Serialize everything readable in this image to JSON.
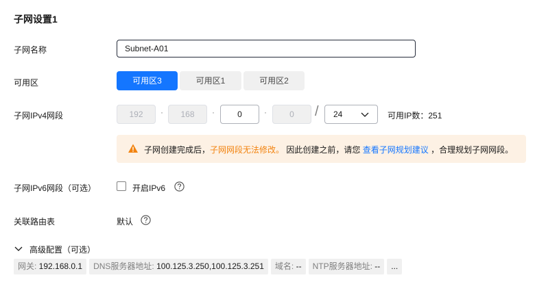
{
  "section": {
    "title": "子网设置1"
  },
  "name": {
    "label": "子网名称",
    "value": "Subnet-A01"
  },
  "az": {
    "label": "可用区",
    "options": [
      "可用区3",
      "可用区1",
      "可用区2"
    ],
    "selected": "可用区3"
  },
  "ipv4": {
    "label": "子网IPv4网段",
    "octets": [
      "192",
      "168",
      "0",
      "0"
    ],
    "dot": "·",
    "slash": "/",
    "mask": "24",
    "available_label": "可用IP数：",
    "available_count": "251"
  },
  "alert": {
    "text1": "子网创建完成后，",
    "text2": "子网网段无法修改。",
    "text3": "因此创建之前，请您",
    "link": "查看子网规划建议",
    "text4": "，合理规划子网网段。"
  },
  "ipv6": {
    "label": "子网IPv6网段（可选）",
    "checkbox_label": "开启IPv6",
    "checked": false
  },
  "route": {
    "label": "关联路由表",
    "value": "默认"
  },
  "advanced": {
    "label": "高级配置（可选）",
    "tags": [
      {
        "key": "网关: ",
        "value": "192.168.0.1"
      },
      {
        "key": "DNS服务器地址: ",
        "value": "100.125.3.250,100.125.3.251"
      },
      {
        "key": "域名: ",
        "value": "--"
      },
      {
        "key": "NTP服务器地址: ",
        "value": "--"
      },
      {
        "key": "",
        "value": "..."
      }
    ]
  },
  "colors": {
    "primary": "#1476ff",
    "warning": "#f2830f",
    "alert_bg": "#fdf1e4"
  }
}
